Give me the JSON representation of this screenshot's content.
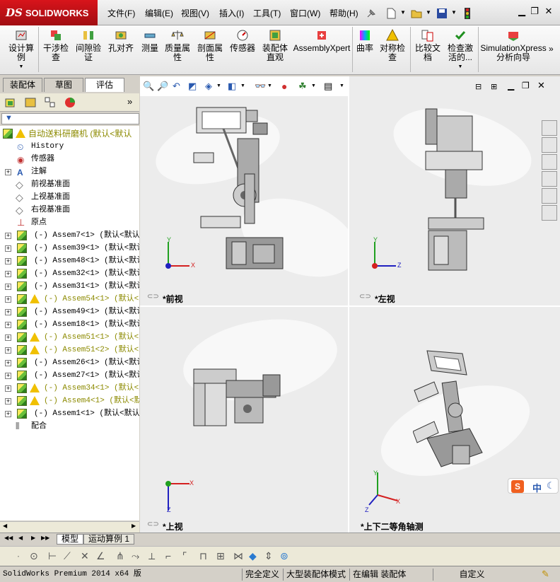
{
  "app": {
    "brand_prefix": "DS",
    "brand_name": "SOLIDWORKS"
  },
  "menu": [
    "文件(F)",
    "编辑(E)",
    "视图(V)",
    "插入(I)",
    "工具(T)",
    "窗口(W)",
    "帮助(H)"
  ],
  "commands": [
    {
      "label": "设计算\n例"
    },
    {
      "label": "干涉检\n查"
    },
    {
      "label": "间隙验\n证"
    },
    {
      "label": "孔对齐"
    },
    {
      "label": "测量"
    },
    {
      "label": "质量属\n性"
    },
    {
      "label": "剖面属\n性"
    },
    {
      "label": "传感器"
    },
    {
      "label": "装配体\n直观"
    },
    {
      "label": "AssemblyXpert"
    },
    {
      "label": "曲率"
    },
    {
      "label": "对称检\n查"
    },
    {
      "label": "比较文\n档"
    },
    {
      "label": "检查激\n活的..."
    },
    {
      "label": "SimulationXpress\n分析向导"
    }
  ],
  "panel_tabs": [
    "装配体",
    "草图",
    "评估"
  ],
  "tree": {
    "root": "自动送料研磨机  (默认<默认",
    "items": [
      {
        "label": "History",
        "type": "history"
      },
      {
        "label": "传感器",
        "type": "sensor"
      },
      {
        "label": "注解",
        "type": "annot"
      },
      {
        "label": "前视基准面",
        "type": "plane"
      },
      {
        "label": "上视基准面",
        "type": "plane"
      },
      {
        "label": "右视基准面",
        "type": "plane"
      },
      {
        "label": "原点",
        "type": "origin"
      },
      {
        "label": "(-) Assem7<1> (默认<默认_",
        "type": "asm"
      },
      {
        "label": "(-) Assem39<1> (默认<默认_",
        "type": "asm"
      },
      {
        "label": "(-) Assem48<1> (默认<默认_",
        "type": "asm"
      },
      {
        "label": "(-) Assem32<1> (默认<默认_",
        "type": "asm"
      },
      {
        "label": "(-) Assem31<1> (默认<默认_",
        "type": "asm"
      },
      {
        "label": "(-) Assem54<1> (默认<默",
        "type": "warn"
      },
      {
        "label": "(-) Assem49<1> (默认<默认_",
        "type": "asm"
      },
      {
        "label": "(-) Assem18<1> (默认<默认_",
        "type": "asm"
      },
      {
        "label": "(-) Assem51<1> (默认<默",
        "type": "warn"
      },
      {
        "label": "(-) Assem51<2> (默认<默",
        "type": "warn"
      },
      {
        "label": "(-) Assem26<1> (默认<默认_",
        "type": "asm"
      },
      {
        "label": "(-) Assem27<1> (默认<默认_",
        "type": "asm"
      },
      {
        "label": "(-) Assem34<1> (默认<默",
        "type": "warn"
      },
      {
        "label": "(-) Assem4<1> (默认<默认",
        "type": "warn"
      },
      {
        "label": "(-) Assem1<1> (默认<默认_",
        "type": "asm"
      },
      {
        "label": "配合",
        "type": "mate"
      }
    ]
  },
  "views": {
    "front": "*前视",
    "left": "*左视",
    "top": "*上视",
    "iso": "*上下二等角轴测"
  },
  "axes": {
    "x": "X",
    "y": "Y",
    "z": "Z"
  },
  "bottom_tabs": [
    "模型",
    "运动算例 1"
  ],
  "status": {
    "version": "SolidWorks Premium 2014 x64 版",
    "defined": "完全定义",
    "mode": "大型装配体模式",
    "editing": "在编辑 装配体",
    "custom": "自定义"
  },
  "ime": "中",
  "colors": {
    "brand_red": "#c8101a",
    "warn": "#8c8a00",
    "axis_x": "#d42020",
    "axis_y": "#20a020",
    "axis_z": "#2020c0"
  }
}
